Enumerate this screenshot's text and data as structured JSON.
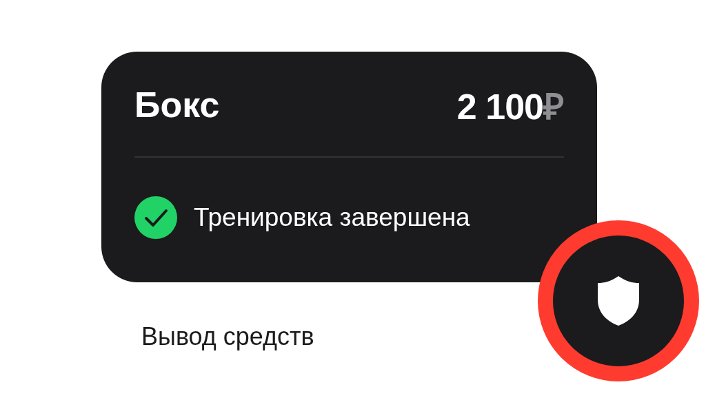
{
  "card": {
    "title": "Бокс",
    "price": "2 100",
    "currency": "₽",
    "status": {
      "text": "Тренировка завершена",
      "done": true
    }
  },
  "caption": "Вывод средств",
  "badge": {
    "kind": "shield"
  }
}
